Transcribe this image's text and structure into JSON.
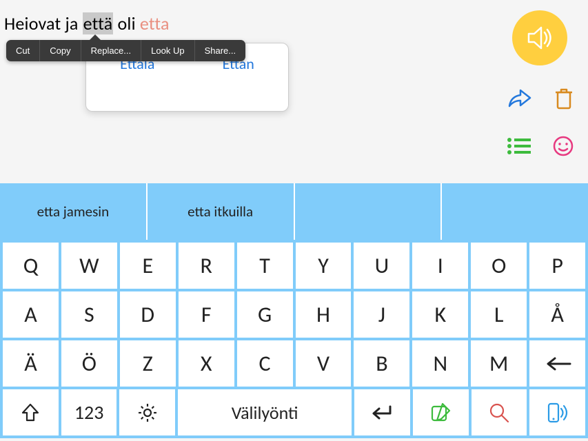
{
  "text": {
    "pre": "Heiovat ja ",
    "selected": "että",
    "post": " oli ",
    "inline_suggestion": "etta"
  },
  "context_menu": {
    "items": [
      "Cut",
      "Copy",
      "Replace...",
      "Look Up",
      "Share..."
    ]
  },
  "popover": {
    "options": [
      "Ettala",
      "Ettan"
    ]
  },
  "predictions": [
    "etta jamesin",
    "etta itkuilla",
    "",
    ""
  ],
  "keyboard": {
    "row1": [
      "Q",
      "W",
      "E",
      "R",
      "T",
      "Y",
      "U",
      "I",
      "O",
      "P"
    ],
    "row2": [
      "A",
      "S",
      "D",
      "F",
      "G",
      "H",
      "J",
      "K",
      "L",
      "Å"
    ],
    "row3": [
      "Ä",
      "Ö",
      "Z",
      "X",
      "C",
      "V",
      "B",
      "N",
      "M"
    ],
    "row4": {
      "numbers": "123",
      "space": "Välilyönti"
    }
  },
  "colors": {
    "accent_blue": "#80ccfa",
    "yellow": "#ffcf3f",
    "share_blue": "#2478dc",
    "trash": "#d88a1f",
    "list_green": "#3dbb3d",
    "smiley_pink": "#e73武",
    "search_red": "#d9534f",
    "device_blue": "#2b9be6"
  }
}
